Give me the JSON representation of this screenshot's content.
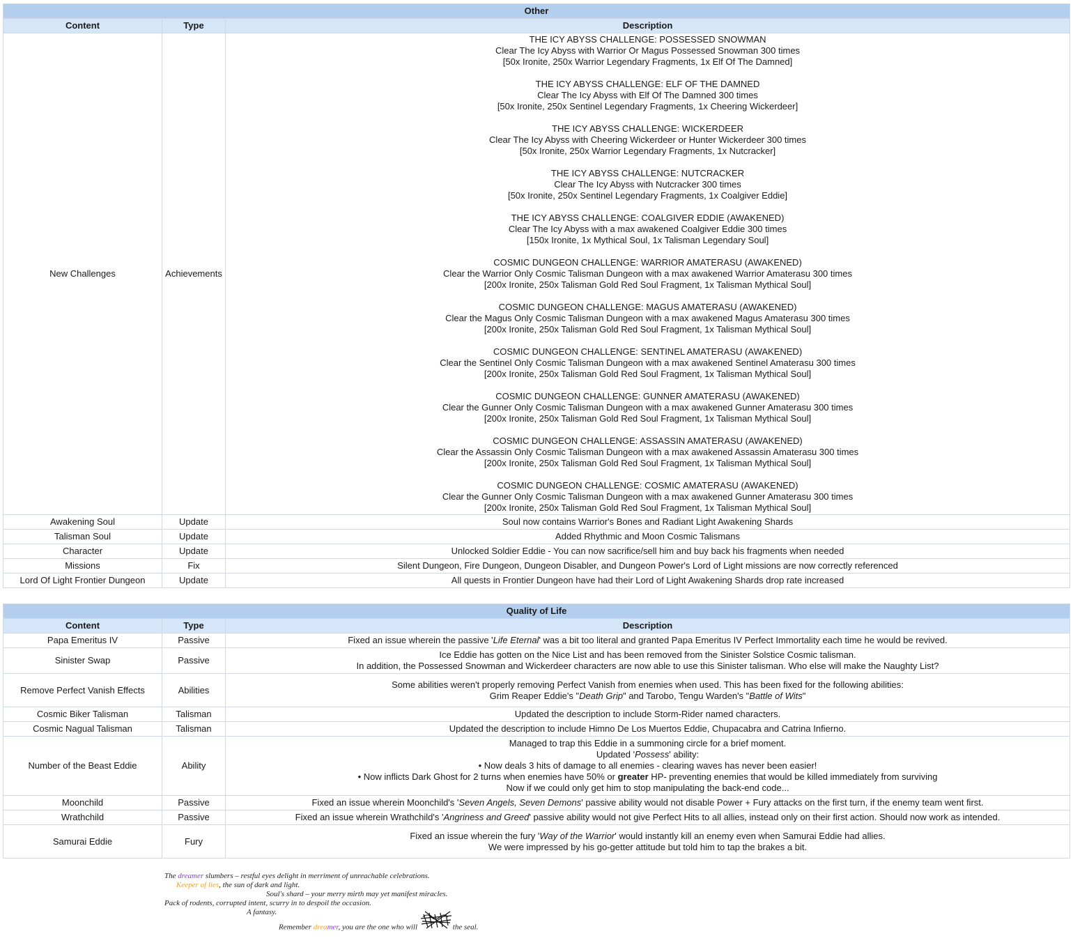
{
  "other": {
    "title": "Other",
    "headers": {
      "content": "Content",
      "type": "Type",
      "description": "Description"
    },
    "challenges": {
      "content": "New Challenges",
      "type": "Achievements",
      "entries": [
        [
          "THE ICY ABYSS CHALLENGE: POSSESSED SNOWMAN",
          "Clear The Icy Abyss with Warrior Or Magus Possessed Snowman 300 times",
          "[50x Ironite, 250x Warrior Legendary Fragments, 1x Elf Of The Damned]"
        ],
        [
          "THE ICY ABYSS CHALLENGE: ELF OF THE DAMNED",
          "Clear The Icy Abyss with Elf Of The Damned 300 times",
          "[50x Ironite, 250x Sentinel Legendary Fragments, 1x Cheering Wickerdeer]"
        ],
        [
          "THE ICY ABYSS CHALLENGE: WICKERDEER",
          "Clear The Icy Abyss with Cheering Wickerdeer or Hunter Wickerdeer 300 times",
          "[50x Ironite, 250x Warrior Legendary Fragments, 1x Nutcracker]"
        ],
        [
          "THE ICY ABYSS CHALLENGE: NUTCRACKER",
          "Clear The Icy Abyss with Nutcracker 300 times",
          "[50x Ironite, 250x Sentinel Legendary Fragments, 1x Coalgiver Eddie]"
        ],
        [
          "THE ICY ABYSS CHALLENGE: COALGIVER EDDIE (AWAKENED)",
          "Clear The Icy Abyss with a max awakened Coalgiver Eddie 300 times",
          "[150x Ironite, 1x Mythical Soul, 1x Talisman Legendary Soul]"
        ],
        [
          "COSMIC DUNGEON CHALLENGE: WARRIOR AMATERASU (AWAKENED)",
          "Clear the Warrior Only Cosmic Talisman Dungeon with a max awakened Warrior Amaterasu 300 times",
          "[200x Ironite, 250x Talisman Gold Red Soul Fragment, 1x Talisman Mythical Soul]"
        ],
        [
          "COSMIC DUNGEON CHALLENGE: MAGUS AMATERASU (AWAKENED)",
          "Clear the Magus Only Cosmic Talisman Dungeon with a max awakened Magus Amaterasu 300 times",
          "[200x Ironite, 250x Talisman Gold Red Soul Fragment, 1x Talisman Mythical Soul]"
        ],
        [
          "COSMIC DUNGEON CHALLENGE: SENTINEL AMATERASU (AWAKENED)",
          "Clear the Sentinel Only Cosmic Talisman Dungeon with a max awakened Sentinel Amaterasu 300 times",
          "[200x Ironite, 250x Talisman Gold Red Soul Fragment, 1x Talisman Mythical Soul]"
        ],
        [
          "COSMIC DUNGEON CHALLENGE: GUNNER AMATERASU (AWAKENED)",
          "Clear the Gunner Only Cosmic Talisman Dungeon with a max awakened Gunner Amaterasu 300 times",
          "[200x Ironite, 250x Talisman Gold Red Soul Fragment, 1x Talisman Mythical Soul]"
        ],
        [
          "COSMIC DUNGEON CHALLENGE: ASSASSIN AMATERASU (AWAKENED)",
          "Clear the Assassin Only Cosmic Talisman Dungeon with a max awakened Assassin Amaterasu 300 times",
          "[200x Ironite, 250x Talisman Gold Red Soul Fragment, 1x Talisman Mythical Soul]"
        ],
        [
          "COSMIC DUNGEON CHALLENGE: COSMIC AMATERASU (AWAKENED)",
          "Clear the Gunner Only Cosmic Talisman Dungeon with a max awakened Gunner Amaterasu 300 times",
          "[200x Ironite, 250x Talisman Gold Red Soul Fragment, 1x Talisman Mythical Soul]"
        ]
      ]
    },
    "rows": [
      {
        "content": "Awakening Soul",
        "type": "Update",
        "description": "Soul now contains Warrior's Bones and Radiant Light Awakening Shards"
      },
      {
        "content": "Talisman Soul",
        "type": "Update",
        "description": "Added Rhythmic and Moon Cosmic Talismans"
      },
      {
        "content": "Character",
        "type": "Update",
        "description": "Unlocked Soldier Eddie - You can now sacrifice/sell him and buy back his fragments when needed"
      },
      {
        "content": "Missions",
        "type": "Fix",
        "description": "Silent Dungeon, Fire Dungeon, Dungeon Disabler, and Dungeon Power's Lord of Light missions are now correctly referenced"
      },
      {
        "content": "Lord Of Light Frontier Dungeon",
        "type": "Update",
        "description": "All quests in Frontier Dungeon have had their Lord of Light Awakening Shards drop rate increased"
      }
    ]
  },
  "qol": {
    "title": "Quality of Life",
    "headers": {
      "content": "Content",
      "type": "Type",
      "description": "Description"
    },
    "rows": [
      {
        "content": "Papa Emeritus IV",
        "type": "Passive",
        "lines": [
          [
            "Fixed an issue wherein the passive '",
            "Life Eternal",
            "' was a bit too literal and granted Papa Emeritus IV Perfect Immortality each time he would be revived."
          ]
        ]
      },
      {
        "content": "Sinister Swap",
        "type": "Passive",
        "lines": [
          [
            "Ice Eddie has gotten on the Nice List and has been removed from the Sinister Solstice Cosmic talisman."
          ],
          [
            "In addition, the Possessed Snowman and Wickerdeer characters are now able to use this Sinister talisman. Who else will make the Naughty List?"
          ]
        ]
      },
      {
        "content": "Remove Perfect Vanish Effects",
        "type": "Abilities",
        "lines": [
          [
            "Some abilities weren't properly removing Perfect Vanish from enemies when used. This has been fixed for the following abilities:"
          ],
          [
            "Grim Reaper Eddie's \"",
            "Death Grip",
            "\" and Tarobo, Tengu Warden's \"",
            "Battle of Wits",
            "\""
          ]
        ]
      },
      {
        "content": "Cosmic Biker Talisman",
        "type": "Talisman",
        "lines": [
          [
            "Updated the description to include Storm-Rider named characters."
          ]
        ]
      },
      {
        "content": "Cosmic Nagual Talisman",
        "type": "Talisman",
        "lines": [
          [
            "Updated the description to include Himno De Los Muertos Eddie, Chupacabra and Catrina Infierno."
          ]
        ]
      },
      {
        "content": "Number of the Beast Eddie",
        "type": "Ability",
        "lines": [
          [
            "Managed to trap this Eddie in a summoning circle for a brief moment."
          ],
          [
            "Updated '",
            "Possess",
            "' ability:"
          ],
          [
            "• Now deals 3 hits of damage to all enemies - clearing waves has never been easier!"
          ],
          [
            "• Now inflicts Dark Ghost for 2 turns when enemies have 50% or ",
            "greater",
            " HP- preventing enemies that would be killed immediately from surviving"
          ],
          [
            "Now if we could only get him to stop manipulating the back-end code..."
          ]
        ]
      },
      {
        "content": "Moonchild",
        "type": "Passive",
        "lines": [
          [
            "Fixed an issue wherein Moonchild's '",
            "Seven Angels, Seven Demons",
            "' passive ability would not disable Power + Fury attacks on the first turn, if the enemy team went first."
          ]
        ]
      },
      {
        "content": "Wrathchild",
        "type": "Passive",
        "lines": [
          [
            "Fixed an issue wherein Wrathchild's '",
            "Angriness and Greed",
            "' passive ability would not give Perfect Hits to all allies, instead only on their first action. Should now work as intended."
          ]
        ]
      },
      {
        "content": "Samurai Eddie",
        "type": "Fury",
        "lines": [
          [
            "Fixed an issue wherein the fury '",
            "Way of the Warrior",
            "' would instantly kill an enemy even when Samurai Eddie had allies."
          ],
          [
            "We were impressed by his go-getter attitude but told him to tap the brakes a bit."
          ]
        ]
      }
    ]
  },
  "poem": {
    "l1a": "The ",
    "l1b": "dreamer",
    "l1c": " slumbers – restful eyes delight in merriment of unreachable celebrations.",
    "l2a": "Keeper of lies",
    "l2b": ", the sun of dark and light.",
    "l3": "Soul's shard – your merry mirth may yet manifest miracles.",
    "l4": "Pack of rodents, corrupted intent, scurry in to despoil the occasion.",
    "l5": "A fantasy.",
    "l6a": "Remember ",
    "l6b": "drea",
    "l6c": "mer",
    "l6d": ", you are the one who will ",
    "l6e": "the seal.",
    "colors": {
      "purple": "#8a3fd6",
      "orange": "#e5a33a"
    }
  }
}
